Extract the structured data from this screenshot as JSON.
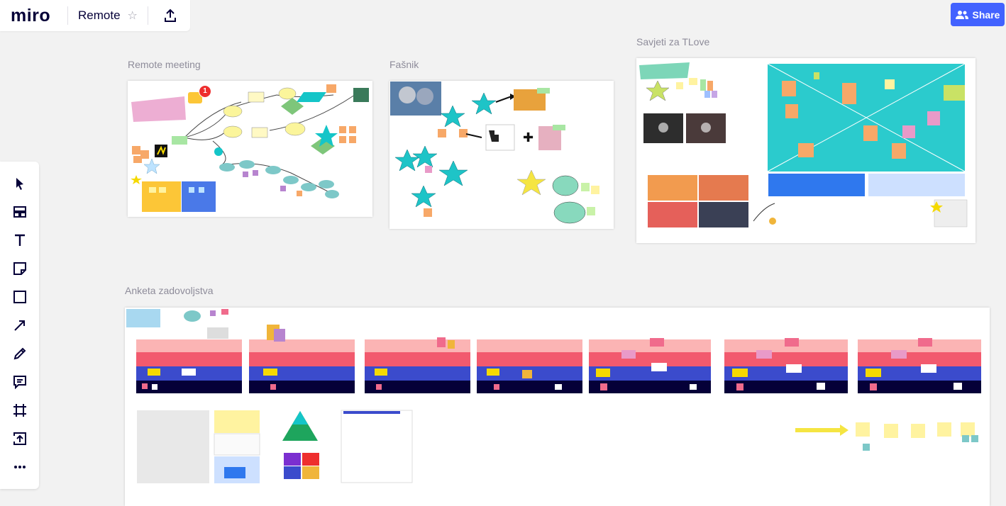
{
  "app": {
    "logo": "miro",
    "board_name": "Remote"
  },
  "share": {
    "label": "Share"
  },
  "frames": [
    {
      "title": "Remote meeting"
    },
    {
      "title": "Fašnik"
    },
    {
      "title": "Savjeti za TLove"
    },
    {
      "title": "Anketa zadovoljstva"
    }
  ],
  "notifications": {
    "count": "1"
  },
  "tools": [
    "select",
    "templates",
    "text",
    "sticky-note",
    "shape",
    "arrow",
    "pen",
    "comment",
    "frame",
    "upload",
    "more"
  ],
  "colors": {
    "accent": "#4262ff",
    "badge": "#ee2e2e",
    "frame_bg": "#ffffff",
    "canvas": "#f2f2f2"
  }
}
